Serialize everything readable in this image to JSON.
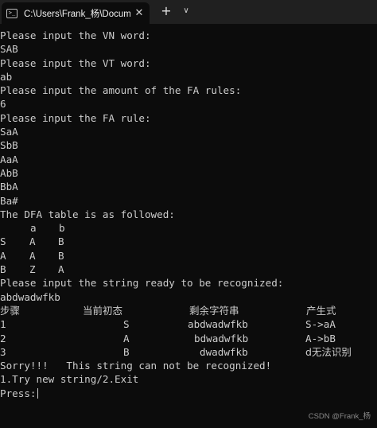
{
  "window": {
    "tab_icon_glyph": ">_",
    "tab_title": "C:\\Users\\Frank_杨\\Documents",
    "close_glyph": "✕",
    "new_tab_glyph": "+",
    "dropdown_glyph": "∨"
  },
  "console": {
    "lines": [
      "Please input the VN word:",
      "SAB",
      "Please input the VT word:",
      "ab",
      "Please input the amount of the FA rules:",
      "6",
      "Please input the FA rule:",
      "SaA",
      "SbB",
      "AaA",
      "AbB",
      "BbA",
      "Ba#",
      "The DFA table is as followed:"
    ],
    "dfa_header": {
      "a": "a",
      "b": "b"
    },
    "dfa_rows": [
      {
        "state": "S",
        "a": "A",
        "b": "B"
      },
      {
        "state": "A",
        "a": "A",
        "b": "B"
      },
      {
        "state": "B",
        "a": "Z",
        "b": "A"
      }
    ],
    "prompt_string": "Please input the string ready to be recognized:",
    "input_string": "abdwadwfkb",
    "trace_header": {
      "step": "步骤",
      "state": "当前初态",
      "rest": "剩余字符串",
      "rule": "产生式"
    },
    "trace_rows": [
      {
        "step": "1",
        "state": "S",
        "rest": "abdwadwfkb",
        "rule": "S->aA"
      },
      {
        "step": "2",
        "state": "A",
        "rest": "bdwadwfkb",
        "rule": "A->bB"
      },
      {
        "step": "3",
        "state": "B",
        "rest": "dwadwfkb",
        "rule": "d无法识别"
      }
    ],
    "result_line": "Sorry!!!   This string can not be recognized!",
    "menu_line": "1.Try new string/2.Exit",
    "press_line": "Press:"
  },
  "watermark": "CSDN @Frank_杨"
}
